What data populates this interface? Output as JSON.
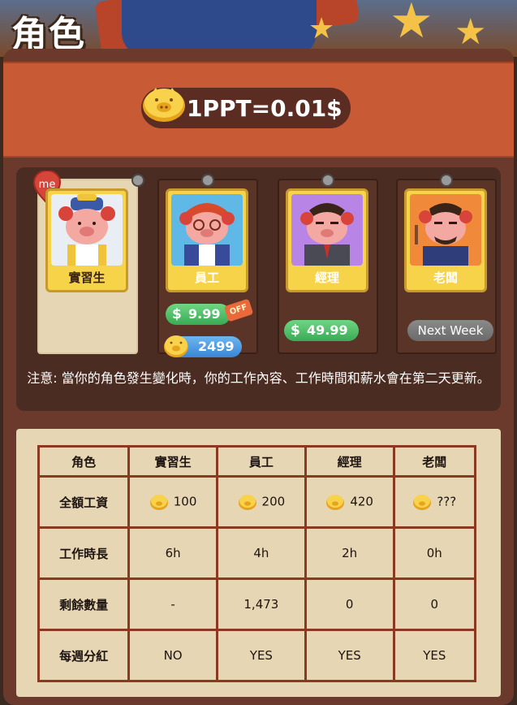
{
  "header": {
    "title": "角色"
  },
  "rate": {
    "text": "1PPT=0.01$"
  },
  "roles": [
    {
      "label": "實習生",
      "current": true,
      "me_badge": "me"
    },
    {
      "label": "員工",
      "price_usd": "9.99",
      "off_tag": "OFF",
      "price_coin": "2499"
    },
    {
      "label": "經理",
      "price_usd": "49.99"
    },
    {
      "label": "老闆",
      "status": "Next Week"
    }
  ],
  "note": "注意: 當你的角色發生變化時，你的工作內容、工作時間和薪水會在第二天更新。",
  "table": {
    "headers": [
      "角色",
      "實習生",
      "員工",
      "經理",
      "老闆"
    ],
    "rows": [
      {
        "label": "全額工資",
        "values": [
          "100",
          "200",
          "420",
          "???"
        ],
        "coin": true
      },
      {
        "label": "工作時長",
        "values": [
          "6h",
          "4h",
          "2h",
          "0h"
        ]
      },
      {
        "label": "剩餘數量",
        "values": [
          "-",
          "1,473",
          "0",
          "0"
        ]
      },
      {
        "label": "每週分紅",
        "values": [
          "NO",
          "YES",
          "YES",
          "YES"
        ]
      }
    ]
  },
  "icons": {
    "coin": "pig-coin-icon",
    "pin": "pin-icon",
    "me": "me-badge-icon",
    "dollar": "dollar-icon"
  },
  "colors": {
    "panel": "#6b3a2d",
    "rate_bar": "#c85a36",
    "card_bg": "#5b3428",
    "current_card": "#e6d6b4",
    "portrait_frame": "#f7d34a",
    "green_pill": "#3aaa55",
    "blue_pill": "#3a86d6",
    "gray_pill": "#6a6a6a",
    "table_bg": "#e6d6b4",
    "table_border": "#8b3a22"
  }
}
